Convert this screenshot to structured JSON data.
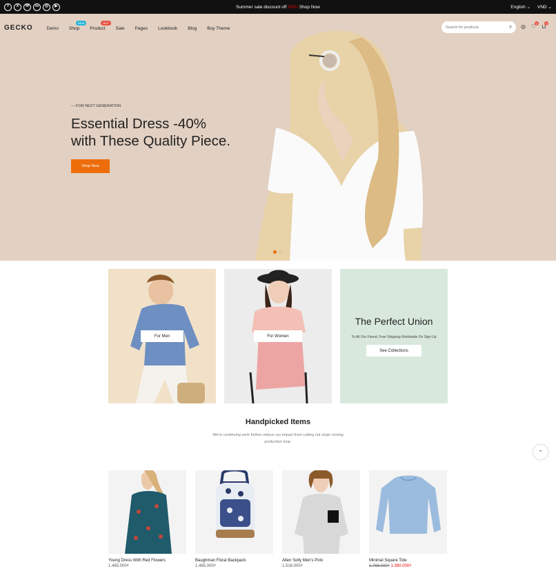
{
  "topbar": {
    "socials": [
      "f",
      "X",
      "✉",
      "in",
      "◎",
      "▶"
    ],
    "promo_text": "Summer sale discount off",
    "promo_pct": "50%!",
    "promo_link": "Shop Now",
    "language": "English",
    "currency": "VND"
  },
  "header": {
    "logo": "GECKO",
    "nav": [
      {
        "label": "Demo"
      },
      {
        "label": "Shop",
        "badge": "NEW",
        "badge_color": "#26b5d9"
      },
      {
        "label": "Product",
        "badge": "HOT",
        "badge_color": "#e95144"
      },
      {
        "label": "Sale"
      },
      {
        "label": "Pages"
      },
      {
        "label": "Lookbook"
      },
      {
        "label": "Blog"
      },
      {
        "label": "Buy Theme"
      }
    ],
    "search_placeholder": "Search for products",
    "wishlist_count": "0",
    "cart_count": "0"
  },
  "hero": {
    "eyebrow": "— FOR NEXT GENERATION",
    "headline_1": "Essential Dress -40%",
    "headline_2": "with These Quality Piece.",
    "cta": "Shop Now",
    "bg_color": "#e2d0c2",
    "accent": "#ec6d0a"
  },
  "tiles": {
    "men": "For Men",
    "women": "For Women",
    "union_title": "The Perfect Union",
    "union_text": "To All Our Friend, Free Shipping Worldwide On Sign Up",
    "union_button": "See Collections"
  },
  "handpicked": {
    "title": "Handpicked Items",
    "subtitle": "We're continuing work further reduce our impact from cutting out virgin closing production loop."
  },
  "products": [
    {
      "name": "Young Dress With Red Flowers",
      "price": "1.465.000₫"
    },
    {
      "name": "Baughman Floral Backpack",
      "price": "1.465.000₫"
    },
    {
      "name": "Allen Solly Men's Polo",
      "price": "1.516.000₫"
    },
    {
      "name": "Minimal Square Tote",
      "old_price": "1.768.000₫",
      "price": "1.390.000₫"
    }
  ]
}
